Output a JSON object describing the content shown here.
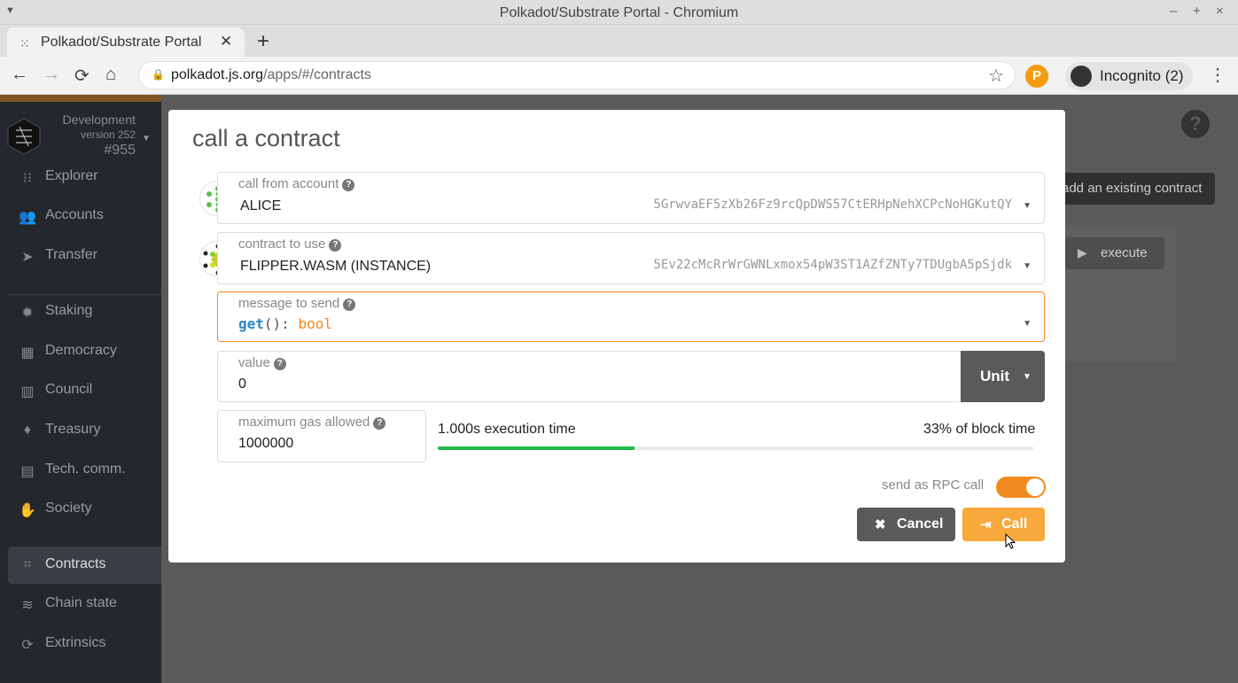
{
  "window": {
    "title": "Polkadot/Substrate Portal - Chromium",
    "minimize": "–",
    "maximize": "+",
    "close": "×"
  },
  "browser": {
    "tab_title": "Polkadot/Substrate Portal",
    "tab_close": "✕",
    "new_tab": "+",
    "url_host": "polkadot.js.org",
    "url_path": "/apps/#/contracts",
    "extension_label": "P",
    "incognito_label": "Incognito (2)"
  },
  "sidebar": {
    "network": "Development",
    "version": "version 252",
    "block": "#955",
    "items": [
      {
        "label": "Explorer",
        "icon": "explorer-icon",
        "glyph": "⁝⁝"
      },
      {
        "label": "Accounts",
        "icon": "accounts-icon",
        "glyph": "👥"
      },
      {
        "label": "Transfer",
        "icon": "transfer-icon",
        "glyph": "➤"
      },
      {
        "label": "Staking",
        "icon": "staking-icon",
        "glyph": "✹"
      },
      {
        "label": "Democracy",
        "icon": "democracy-icon",
        "glyph": "▦"
      },
      {
        "label": "Council",
        "icon": "council-icon",
        "glyph": "▥"
      },
      {
        "label": "Treasury",
        "icon": "treasury-icon",
        "glyph": "♦"
      },
      {
        "label": "Tech. comm.",
        "icon": "tech-comm-icon",
        "glyph": "▤"
      },
      {
        "label": "Society",
        "icon": "society-icon",
        "glyph": "✋"
      },
      {
        "label": "Contracts",
        "icon": "contracts-icon",
        "glyph": "⌗"
      },
      {
        "label": "Chain state",
        "icon": "chain-state-icon",
        "glyph": "≋"
      },
      {
        "label": "Extrinsics",
        "icon": "extrinsics-icon",
        "glyph": "⟳"
      }
    ],
    "active_item": "Contracts"
  },
  "background": {
    "help": "?",
    "add_contract_label": "add an existing contract",
    "execute_label": "execute"
  },
  "modal": {
    "title": "call a contract",
    "account": {
      "label": "call from account",
      "name": "ALICE",
      "address": "5GrwvaEF5zXb26Fz9rcQpDWS57CtERHpNehXCPcNoHGKutQY"
    },
    "contract": {
      "label": "contract to use",
      "name": "FLIPPER.WASM (INSTANCE)",
      "address": "5Ev22cMcRrWrGWNLxmox54pW3ST1AZfZNTy7TDUgbA5pSjdk"
    },
    "message": {
      "label": "message to send",
      "fn_name": "get",
      "fn_args": "(): ",
      "return_type": "bool"
    },
    "value": {
      "label": "value",
      "amount": "0",
      "unit": "Unit"
    },
    "gas": {
      "label": "maximum gas allowed",
      "amount": "1000000",
      "execution_time": "1.000s execution time",
      "block_time": "33% of block time",
      "block_fraction": 0.33
    },
    "rpc": {
      "label": "send as RPC call",
      "enabled": true
    },
    "cancel_label": "Cancel",
    "call_label": "Call"
  },
  "colors": {
    "accent": "#f18a1f",
    "sidebar": "#24272b",
    "progress": "#21ba45"
  }
}
